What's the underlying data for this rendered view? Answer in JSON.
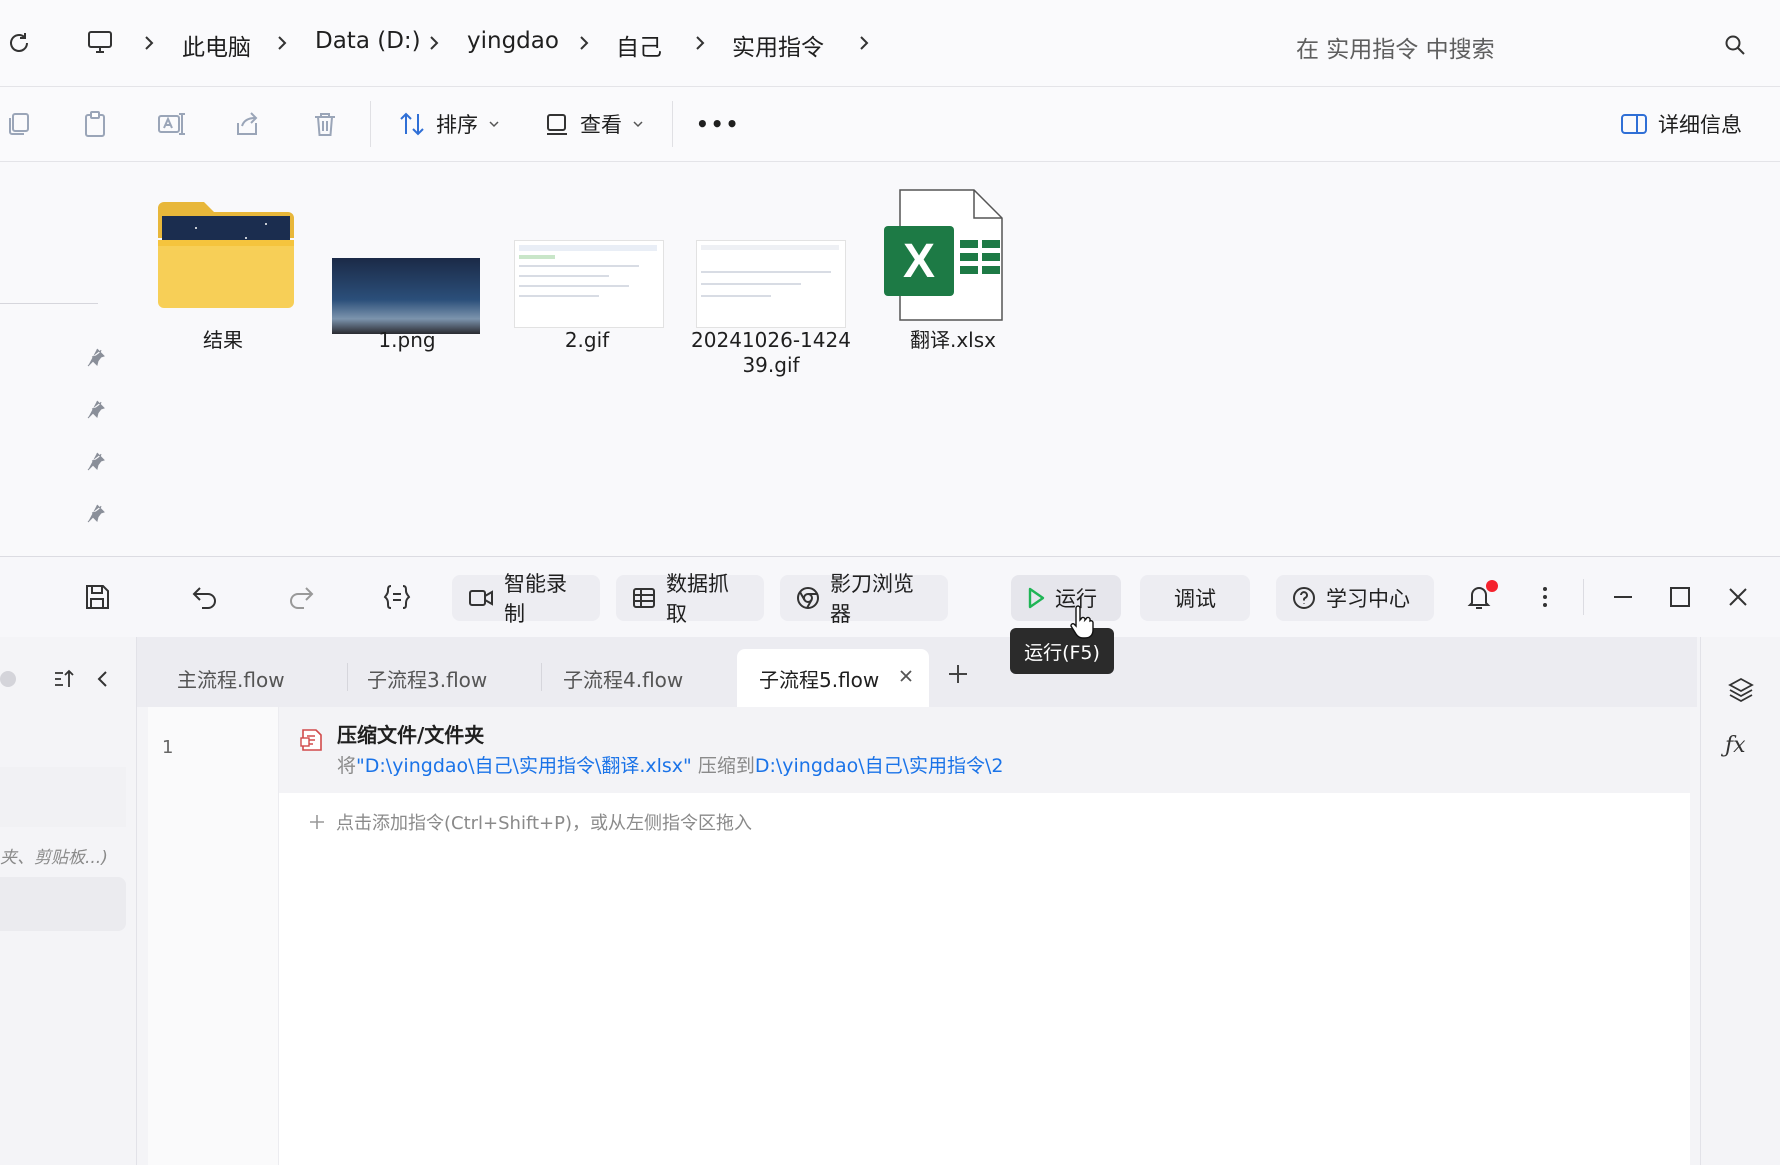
{
  "explorer": {
    "breadcrumb": [
      "此电脑",
      "Data (D:)",
      "yingdao",
      "自己",
      "实用指令"
    ],
    "search_placeholder": "在 实用指令 中搜索",
    "toolbar": {
      "sort_label": "排序",
      "view_label": "查看",
      "more_label": "•••",
      "details_label": "详细信息"
    },
    "files": [
      {
        "name": "结果",
        "type": "folder-icon"
      },
      {
        "name": "1.png",
        "type": "image-thumbnail"
      },
      {
        "name": "2.gif",
        "type": "image-thumbnail"
      },
      {
        "name_line1": "20241026-1424",
        "name_line2": "39.gif",
        "type": "image-thumbnail"
      },
      {
        "name": "翻译.xlsx",
        "type": "excel-icon"
      }
    ]
  },
  "app": {
    "toolbar": {
      "smart_record": "智能录制",
      "data_capture": "数据抓取",
      "browser": "影刀浏览器",
      "run": "运行",
      "debug": "调试",
      "learn": "学习中心",
      "run_tooltip": "运行(F5)"
    },
    "tabs": [
      {
        "label": "主流程.flow",
        "active": false
      },
      {
        "label": "子流程3.flow",
        "active": false
      },
      {
        "label": "子流程4.flow",
        "active": false
      },
      {
        "label": "子流程5.flow",
        "active": true
      }
    ],
    "left_panel": {
      "search_hint": "夹、剪贴板...)"
    },
    "editor": {
      "rows": [
        {
          "line": "1",
          "title": "压缩文件/文件夹",
          "desc_prefix": "将",
          "desc_source": "\"D:\\yingdao\\自己\\实用指令\\翻译.xlsx\"",
          "desc_middle": " 压缩到",
          "desc_target": "D:\\yingdao\\自己\\实用指令\\2"
        }
      ],
      "add_hint": "点击添加指令(Ctrl+Shift+P)，或从左侧指令区拖入"
    },
    "colors": {
      "accent": "#1a73e8",
      "run_green": "#1fb555",
      "excel_green": "#1d7a45",
      "notify_red": "#f5222d"
    }
  }
}
